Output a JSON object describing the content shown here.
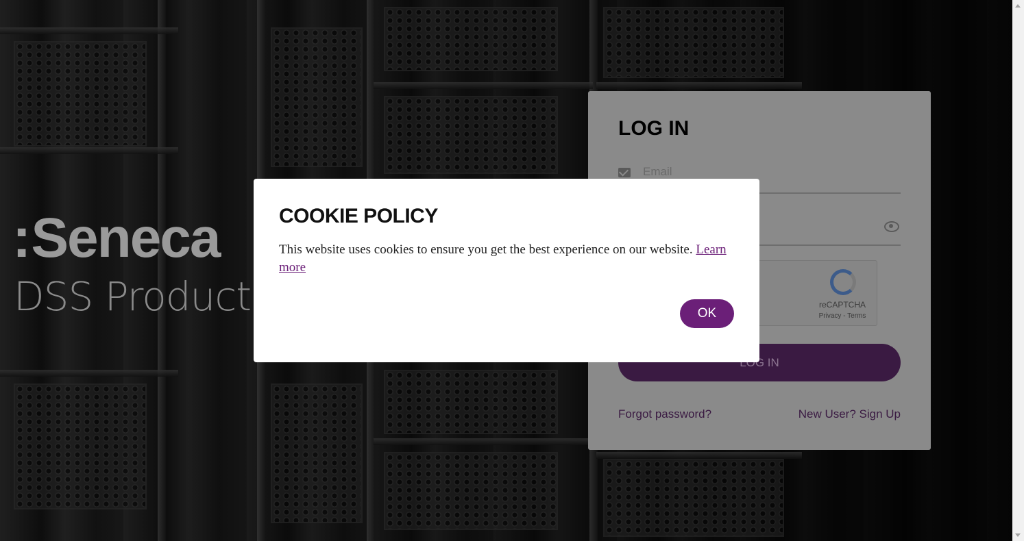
{
  "brand": {
    "logo_dots": ":",
    "logo_text": "Seneca",
    "subtitle": "DSS Product"
  },
  "login": {
    "title": "LOG IN",
    "email_placeholder": "Email",
    "password_placeholder": "",
    "recaptcha_label": "reCAPTCHA",
    "recaptcha_links": "Privacy - Terms",
    "button_label": "LOG IN",
    "forgot_link": "Forgot password?",
    "signup_link": "New User? Sign Up"
  },
  "cookie": {
    "title": "COOKIE POLICY",
    "message": "This website uses cookies to ensure you get the best experience on our website. ",
    "learn_more": "Learn more",
    "ok_label": "OK"
  },
  "icons": {
    "email": "mail-icon",
    "password_toggle": "eye-icon",
    "recaptcha": "recaptcha-logo"
  },
  "colors": {
    "accent": "#6b1f78",
    "modal_bg": "#ffffff",
    "login_card_dimmed": "#8a8a8a"
  }
}
